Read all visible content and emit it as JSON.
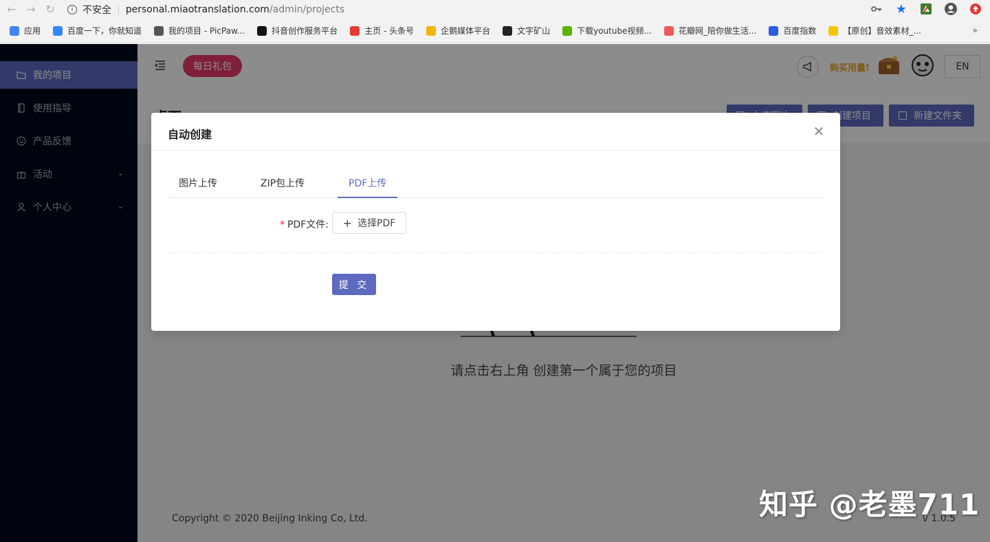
{
  "browser": {
    "security_label": "不安全",
    "url_host": "personal.miaotranslation.com",
    "url_path": "/admin/projects",
    "bookmarks": [
      {
        "label": "应用",
        "color": "#4285f4"
      },
      {
        "label": "百度一下，你就知道",
        "color": "#3385ff"
      },
      {
        "label": "我的项目 - PicPaw...",
        "color": "#555555"
      },
      {
        "label": "抖音创作服务平台",
        "color": "#111111"
      },
      {
        "label": "主页 - 头条号",
        "color": "#e33e33"
      },
      {
        "label": "企鹅媒体平台",
        "color": "#f5b400"
      },
      {
        "label": "文字矿山",
        "color": "#222222"
      },
      {
        "label": "下载youtube视频...",
        "color": "#5cb300"
      },
      {
        "label": "花瓣网_陪你做生活...",
        "color": "#ee5a5a"
      },
      {
        "label": "百度指数",
        "color": "#2b5ce6"
      },
      {
        "label": "【原创】音效素材_...",
        "color": "#f6c400"
      }
    ],
    "more": "»"
  },
  "sidebar": {
    "items": [
      {
        "label": "我的项目"
      },
      {
        "label": "使用指导"
      },
      {
        "label": "产品反馈"
      },
      {
        "label": "活动"
      },
      {
        "label": "个人中心"
      }
    ]
  },
  "header": {
    "gift_label": "每日礼包",
    "buy_label": "购买用量!",
    "lang": "EN"
  },
  "page": {
    "title": "桌面",
    "btn_upload": "上传图片",
    "btn_create": "创建项目",
    "btn_folder": "新建文件夹",
    "empty_text": "请点击右上角 创建第一个属于您的项目"
  },
  "footer": {
    "copyright": "Copyright © 2020 Beijing Inking Co, Ltd.",
    "version": "v 1.0.5"
  },
  "modal": {
    "title": "自动创建",
    "tabs": [
      "图片上传",
      "ZIP包上传",
      "PDF上传"
    ],
    "active_tab": 2,
    "field_label": "PDF文件:",
    "upload_label": "选择PDF",
    "submit": "提 交"
  },
  "watermark": "知乎 @老墨711",
  "colors": {
    "primary": "#5e6ac0",
    "gift": "#e83a6b",
    "sidebar_bg": "#00091b"
  }
}
